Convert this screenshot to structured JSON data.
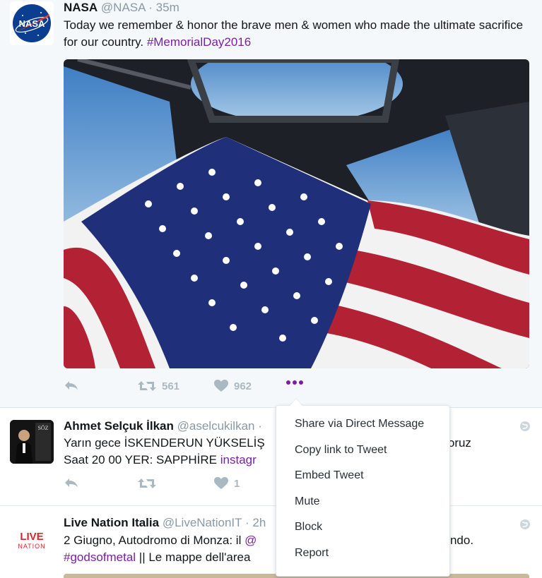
{
  "tweets": [
    {
      "name": "NASA",
      "handle": "@NASA",
      "sep": "·",
      "time": "35m",
      "text": "Today we remember & honor the brave men & women who made the ultimate sacrifice for our country.",
      "hashtag": "#MemorialDay2016",
      "avatar_text": "NASA",
      "media": "photo of an American flag floating inside the space station cupola, Earth visible through the windows",
      "actions": {
        "reply": "",
        "retweet_count": "561",
        "like_count": "962"
      }
    },
    {
      "name": "Ahmet Selçuk İlkan",
      "handle": "@aselcukilkan",
      "sep": "·",
      "line1": "Yarın gece İSKENDERUN YÜKSELİŞ",
      "line1_end": "uluşuyoruz",
      "line2": "Saat 20 00  YER: SAPPHİRE ",
      "line2_link": "instagr",
      "avatar_text": "SÖZ",
      "actions": {
        "reply": "",
        "retweet_count": "",
        "like_count": "1"
      }
    },
    {
      "name": "Live Nation Italia",
      "handle": "@LiveNationIT",
      "sep": "·",
      "time": "2h",
      "line1": "2 Giugno, Autodromo di Monza: il ",
      "line1_link": "@",
      "line1_end": "mando.",
      "line2_hashtag": "#godsofmetal",
      "line2": " || Le mappe dell'area ",
      "avatar_line1": "LIVE",
      "avatar_line2": "NATION"
    }
  ],
  "menu": {
    "items": [
      "Share via Direct Message",
      "Copy link to Tweet",
      "Embed Tweet",
      "Mute",
      "Block",
      "Report"
    ]
  },
  "colors": {
    "accent": "#7b1fa2",
    "muted": "#aab8c2",
    "border": "#e1e8ed"
  }
}
